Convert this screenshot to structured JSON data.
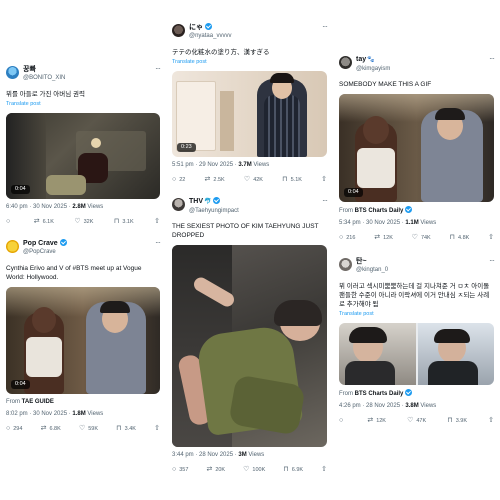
{
  "tweets": [
    {
      "name": "꿍빠",
      "handle": "@BONITO_XIN",
      "text": "뷔를 아들로 가진 아버님 권력",
      "translate": "Translate post",
      "duration": "0:04",
      "time": "6:40 pm · 30 Nov 2025 · ",
      "views": "2.8M",
      "views_label": "Views",
      "replies": "",
      "reposts": "6.1K",
      "likes": "32K",
      "bookmarks": "3.1K"
    },
    {
      "name": "Pop Crave",
      "handle": "@PopCrave",
      "text": "Cynthia Erivo and V of #BTS meet up at Vogue World: Hollywood.",
      "duration": "0:04",
      "from_label": "From",
      "from": "TAE GUIDE",
      "time": "8:02 pm · 30 Nov 2025 · ",
      "views": "1.8M",
      "views_label": "Views",
      "replies": "294",
      "reposts": "6.8K",
      "likes": "59K",
      "bookmarks": "3.4K"
    },
    {
      "name": "にゃ",
      "handle": "@nyataa_vvvvv",
      "text": "テテの化粧水の塗り方、漢すぎる",
      "translate": "Translate post",
      "duration": "0:23",
      "time": "5:51 pm · 29 Nov 2025 · ",
      "views": "3.7M",
      "views_label": "Views",
      "replies": "22",
      "reposts": "2.5K",
      "likes": "42K",
      "bookmarks": "5.1K"
    },
    {
      "name": "THV",
      "emoji": "🐬",
      "handle": "@Taehyungimpact",
      "text": "THE SEXIEST PHOTO OF KIM TAEHYUNG JUST DROPPED",
      "time": "3:44 pm · 28 Nov 2025 · ",
      "views": "3M",
      "views_label": "Views",
      "replies": "357",
      "reposts": "20K",
      "likes": "100K",
      "bookmarks": "6.9K"
    },
    {
      "name": "tay",
      "emoji": "🐾",
      "handle": "@kimgayism",
      "text": "SOMEBODY MAKE THIS A GIF",
      "duration": "0:04",
      "from_label": "From",
      "from": "BTS Charts Daily",
      "time": "5:34 pm · 30 Nov 2025 · ",
      "views": "1.1M",
      "views_label": "Views",
      "replies": "216",
      "reposts": "12K",
      "likes": "74K",
      "bookmarks": "4.8K"
    },
    {
      "name": "탄~",
      "handle": "@kingtan_0",
      "text": "뷔 이러고 섹시미뿜뿜하는데 걸 지나쳐준 거 ㅁㅊ 아이돌 팬들한 수준이 아니라 이락셔에 이거 안내심 ㅈ되는 사례로 추가해야 됨",
      "translate": "Translate post",
      "from_label": "From",
      "from": "BTS Charts Daily",
      "time": "4:26 pm · 28 Nov 2025 · ",
      "views": "3.8M",
      "views_label": "Views",
      "replies": "",
      "reposts": "12K",
      "likes": "47K",
      "bookmarks": "3.9K"
    }
  ],
  "icons": {
    "reply": "reply-icon",
    "repost": "repost-icon",
    "like": "heart-icon",
    "bookmark": "bookmark-icon",
    "share": "share-icon",
    "more": "more-icon"
  },
  "colors": {
    "accent": "#1d9bf0",
    "muted": "#536471",
    "text": "#0f1419"
  }
}
